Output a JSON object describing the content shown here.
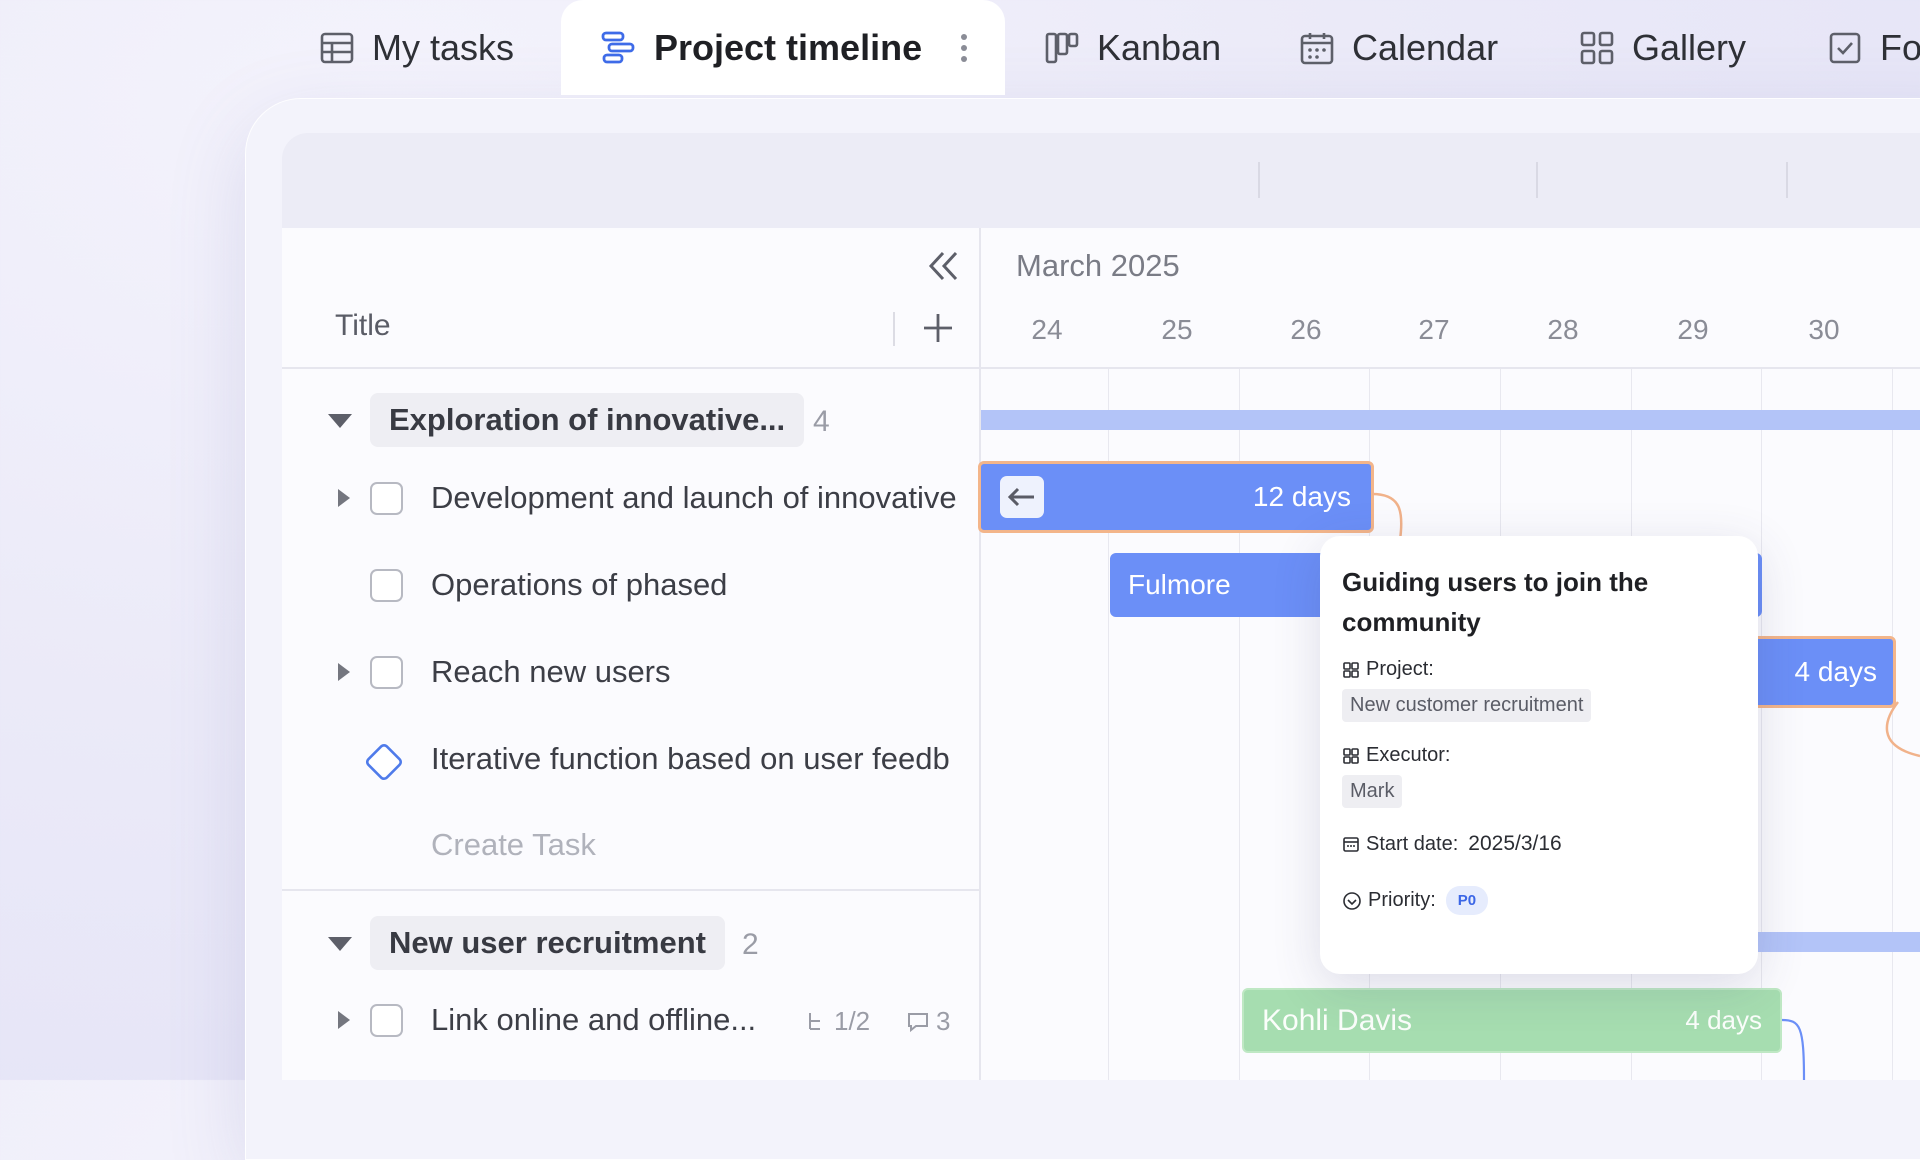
{
  "tabs": [
    {
      "label": "My tasks",
      "icon": "table-icon"
    },
    {
      "label": "Project timeline",
      "icon": "timeline-icon"
    },
    {
      "label": "Kanban",
      "icon": "kanban-icon"
    },
    {
      "label": "Calendar",
      "icon": "calendar-icon"
    },
    {
      "label": "Gallery",
      "icon": "gallery-icon"
    },
    {
      "label": "Fo",
      "icon": "form-icon"
    }
  ],
  "list": {
    "title_header": "Title",
    "create_task": "Create Task",
    "groups": [
      {
        "name": "Exploration of innovative...",
        "count": "4",
        "rows": [
          {
            "title": "Development and launch of innovative"
          },
          {
            "title": "Operations of phased"
          },
          {
            "title": "Reach new users"
          },
          {
            "title": "Iterative function based on user feedb"
          }
        ]
      },
      {
        "name": "New user recruitment",
        "count": "2",
        "rows": [
          {
            "title": "Link online and offline...",
            "subtasks": "1/2",
            "comments": "3"
          }
        ]
      }
    ]
  },
  "timeline": {
    "month": "March 2025",
    "days": [
      "24",
      "25",
      "26",
      "27",
      "28",
      "29",
      "30"
    ],
    "bars": [
      {
        "label": "",
        "duration": "12 days"
      },
      {
        "label": "Fulmore",
        "duration": ""
      },
      {
        "label": "",
        "duration": "4 days"
      },
      {
        "label": "Kohli Davis",
        "duration": "4 days"
      }
    ]
  },
  "tooltip": {
    "title": "Guiding users to join the community",
    "project_label": "Project:",
    "project_value": "New customer recruitment",
    "executor_label": "Executor:",
    "executor_value": "Mark",
    "start_label": "Start date:",
    "start_value": "2025/3/16",
    "priority_label": "Priority:",
    "priority_value": "P0"
  },
  "colors": {
    "accent": "#6b8ff7",
    "group_bar": "#b3c4f8",
    "selected_outline": "#f3b58a",
    "green_bar": "#a6ddb0",
    "priority": "#3b66e6"
  }
}
